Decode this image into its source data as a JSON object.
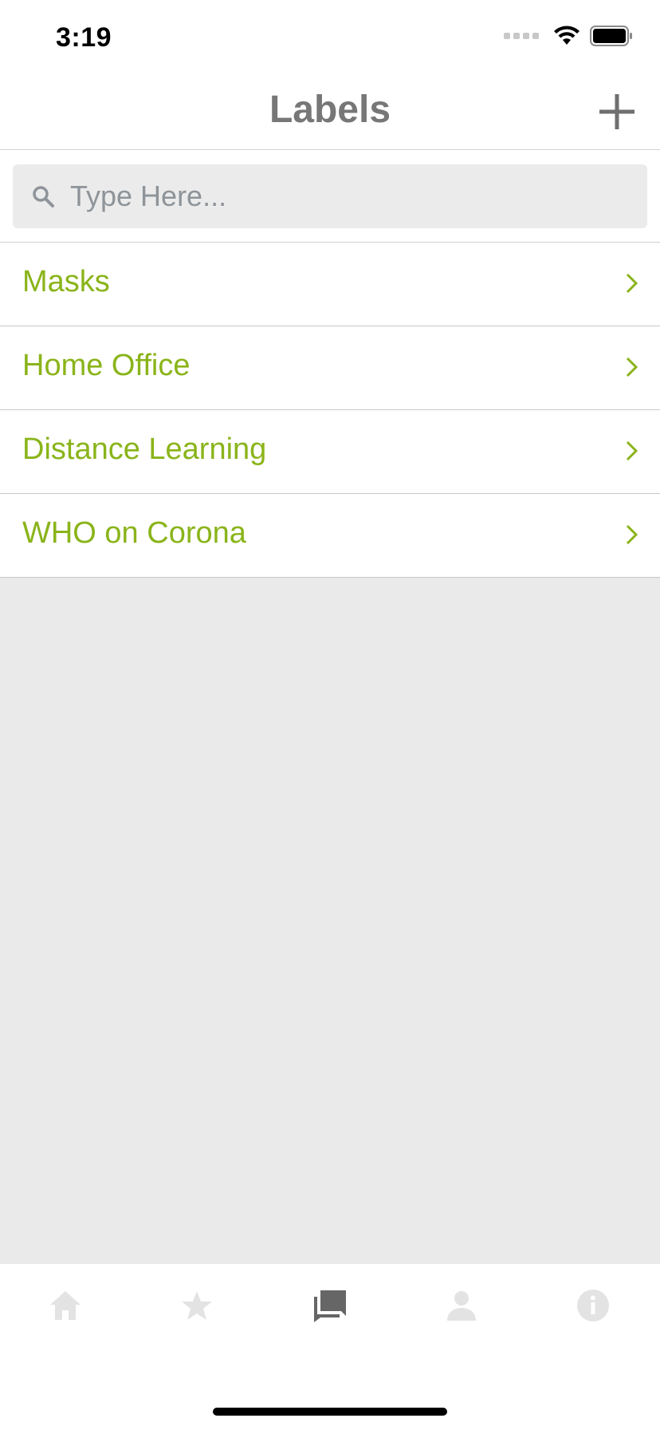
{
  "status_bar": {
    "time": "3:19",
    "icons": [
      "cellular-dots-icon",
      "wifi-icon",
      "battery-icon"
    ]
  },
  "nav": {
    "title": "Labels",
    "add_icon": "plus-icon"
  },
  "search": {
    "placeholder": "Type Here...",
    "value": "",
    "icon": "search-icon"
  },
  "labels": [
    {
      "label": "Masks"
    },
    {
      "label": "Home Office"
    },
    {
      "label": "Distance Learning"
    },
    {
      "label": "WHO on Corona"
    }
  ],
  "tab_bar": {
    "tabs": [
      {
        "icon": "home-icon",
        "active": false
      },
      {
        "icon": "star-icon",
        "active": false
      },
      {
        "icon": "chat-bubbles-icon",
        "active": true
      },
      {
        "icon": "person-icon",
        "active": false
      },
      {
        "icon": "info-icon",
        "active": false
      }
    ]
  },
  "colors": {
    "label_text": "#8ab41a",
    "title_text": "#777777",
    "inactive_tab": "#e0e0e0",
    "active_tab": "#666666",
    "empty_background": "#eaeaea"
  }
}
